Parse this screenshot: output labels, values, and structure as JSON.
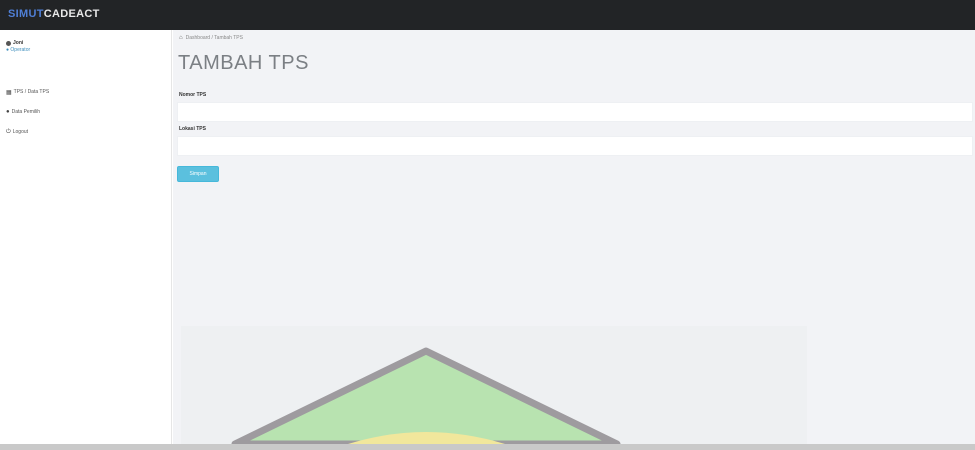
{
  "app": {
    "brand_part1": "SIMUT",
    "brand_part2": "CADEACT"
  },
  "sidebar": {
    "user_name": "Joni",
    "user_role": "● Operator",
    "menu": [
      {
        "label": "TPS / Data TPS",
        "icon": "table-icon"
      },
      {
        "label": "Data Pemilih",
        "icon": "users-icon"
      },
      {
        "label": "Logout",
        "icon": "power-icon"
      }
    ]
  },
  "breadcrumb": {
    "path": "Dashboard / Tambah TPS"
  },
  "page": {
    "title": "TAMBAH TPS"
  },
  "form": {
    "field1_label": "Nomor TPS",
    "field1_value": "",
    "field2_label": "Lokasi TPS",
    "field2_value": "",
    "submit_label": "Simpan"
  },
  "colors": {
    "topbar": "#222426",
    "content_bg": "#f2f3f6",
    "button": "#5bc0de",
    "logo_green": "#b8e3b0",
    "logo_yellow": "#f1e79c",
    "logo_border": "#9e9b9f"
  }
}
